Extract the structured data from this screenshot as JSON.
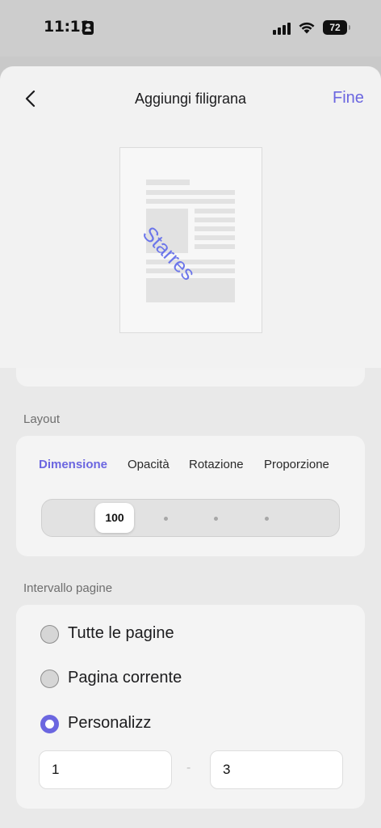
{
  "status_bar": {
    "time": "11:11",
    "battery": "72"
  },
  "modal": {
    "title": "Aggiungi filigrana",
    "done_label": "Fine",
    "watermark_text": "Starres"
  },
  "layout_section": {
    "label": "Layout",
    "tabs": [
      {
        "label": "Dimensione",
        "active": true
      },
      {
        "label": "Opacità",
        "active": false
      },
      {
        "label": "Rotazione",
        "active": false
      },
      {
        "label": "Proporzione",
        "active": false
      }
    ],
    "slider_value": "100"
  },
  "pages_section": {
    "label": "Intervallo pagine",
    "options": [
      {
        "label": "Tutte le pagine",
        "selected": false
      },
      {
        "label": "Pagina corrente",
        "selected": false
      },
      {
        "label": "Personalizz",
        "selected": true
      }
    ],
    "range_from": "1",
    "range_to": "3",
    "range_separator": "-"
  },
  "colors": {
    "accent": "#6b66e0",
    "watermark": "#6b75ea"
  }
}
